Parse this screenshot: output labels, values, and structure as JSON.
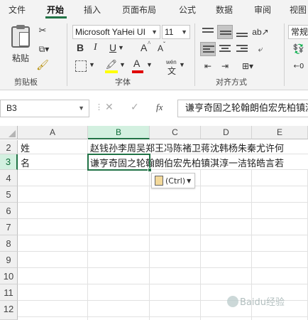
{
  "ribbon_tabs": [
    "文件",
    "开始",
    "插入",
    "页面布局",
    "公式",
    "数据",
    "审阅",
    "视图"
  ],
  "clipboard": {
    "paste_label": "粘贴",
    "group_label": "剪贴板"
  },
  "font": {
    "name": "Microsoft YaHei UI",
    "size": "11",
    "group_label": "字体",
    "bold": "B",
    "italic": "I",
    "underline": "U",
    "grow": "A",
    "shrink": "A",
    "phonetic": "wén"
  },
  "alignment": {
    "group_label": "对齐方式"
  },
  "number": {
    "format": "常规"
  },
  "formula_bar": {
    "cell_ref": "B3",
    "fx": "fx",
    "content": "谦亨奇固之轮翰朗伯宏先柏镇淇淳一洁铭皓言若"
  },
  "columns": [
    "A",
    "B",
    "C",
    "D",
    "E"
  ],
  "rows": [
    "2",
    "3",
    "4",
    "5",
    "6",
    "7",
    "8",
    "9",
    "10",
    "11",
    "12"
  ],
  "cells": {
    "A2": "姓",
    "B2": "赵钱孙李周吴郑王冯陈褚卫蒋沈韩杨朱秦尤许何",
    "A3": "名",
    "B3": "谦亨奇固之轮翰朗伯宏先柏镇淇淳一洁铭皓言若"
  },
  "paste_options": {
    "label": "(Ctrl)"
  },
  "watermark": "Baidu经验",
  "colors": {
    "accent": "#217346",
    "selected_header": "#d3f0e0"
  }
}
